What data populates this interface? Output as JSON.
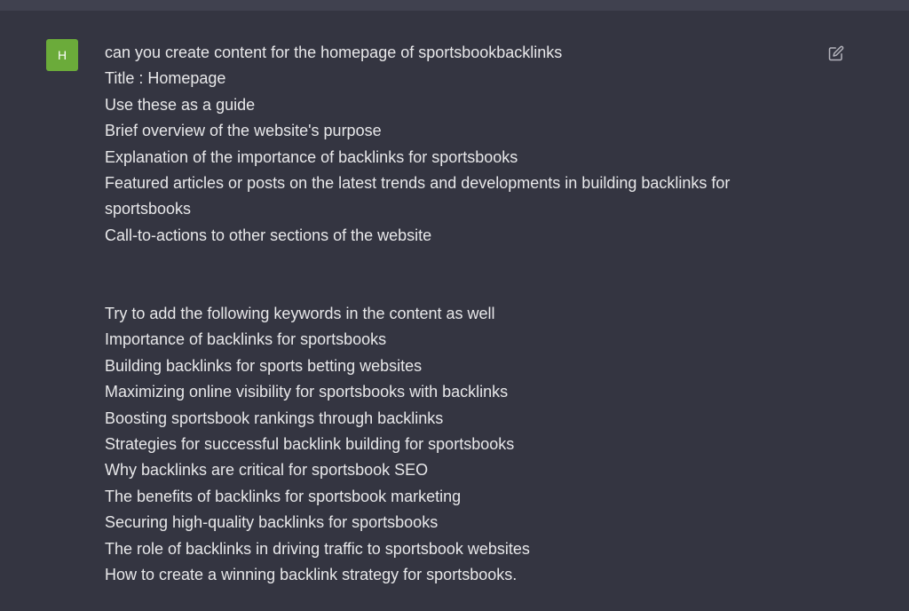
{
  "avatar": {
    "initial": "H",
    "color": "#6bab3a"
  },
  "colors": {
    "background": "#343541",
    "text": "#e8e8ea",
    "topbar": "#40414f"
  },
  "message": {
    "lines_a": [
      "can you create content for the homepage of sportsbookbacklinks",
      "Title : Homepage",
      "Use these as a guide",
      "Brief overview of the website's purpose",
      "Explanation of the importance of backlinks for sportsbooks",
      "Featured articles or posts on the latest trends and developments in building backlinks for",
      "sportsbooks",
      "Call-to-actions to other sections of the website"
    ],
    "lines_b": [
      "Try to add the following keywords in the content as well",
      "Importance of backlinks for sportsbooks",
      "Building backlinks for sports betting websites",
      "Maximizing online visibility for sportsbooks with backlinks",
      "Boosting sportsbook rankings through backlinks",
      "Strategies for successful backlink building for sportsbooks",
      "Why backlinks are critical for sportsbook SEO",
      "The benefits of backlinks for sportsbook marketing",
      "Securing high-quality backlinks for sportsbooks",
      "The role of backlinks in driving traffic to sportsbook websites",
      "How to create a winning backlink strategy for sportsbooks."
    ]
  },
  "icons": {
    "edit": "edit-icon"
  }
}
